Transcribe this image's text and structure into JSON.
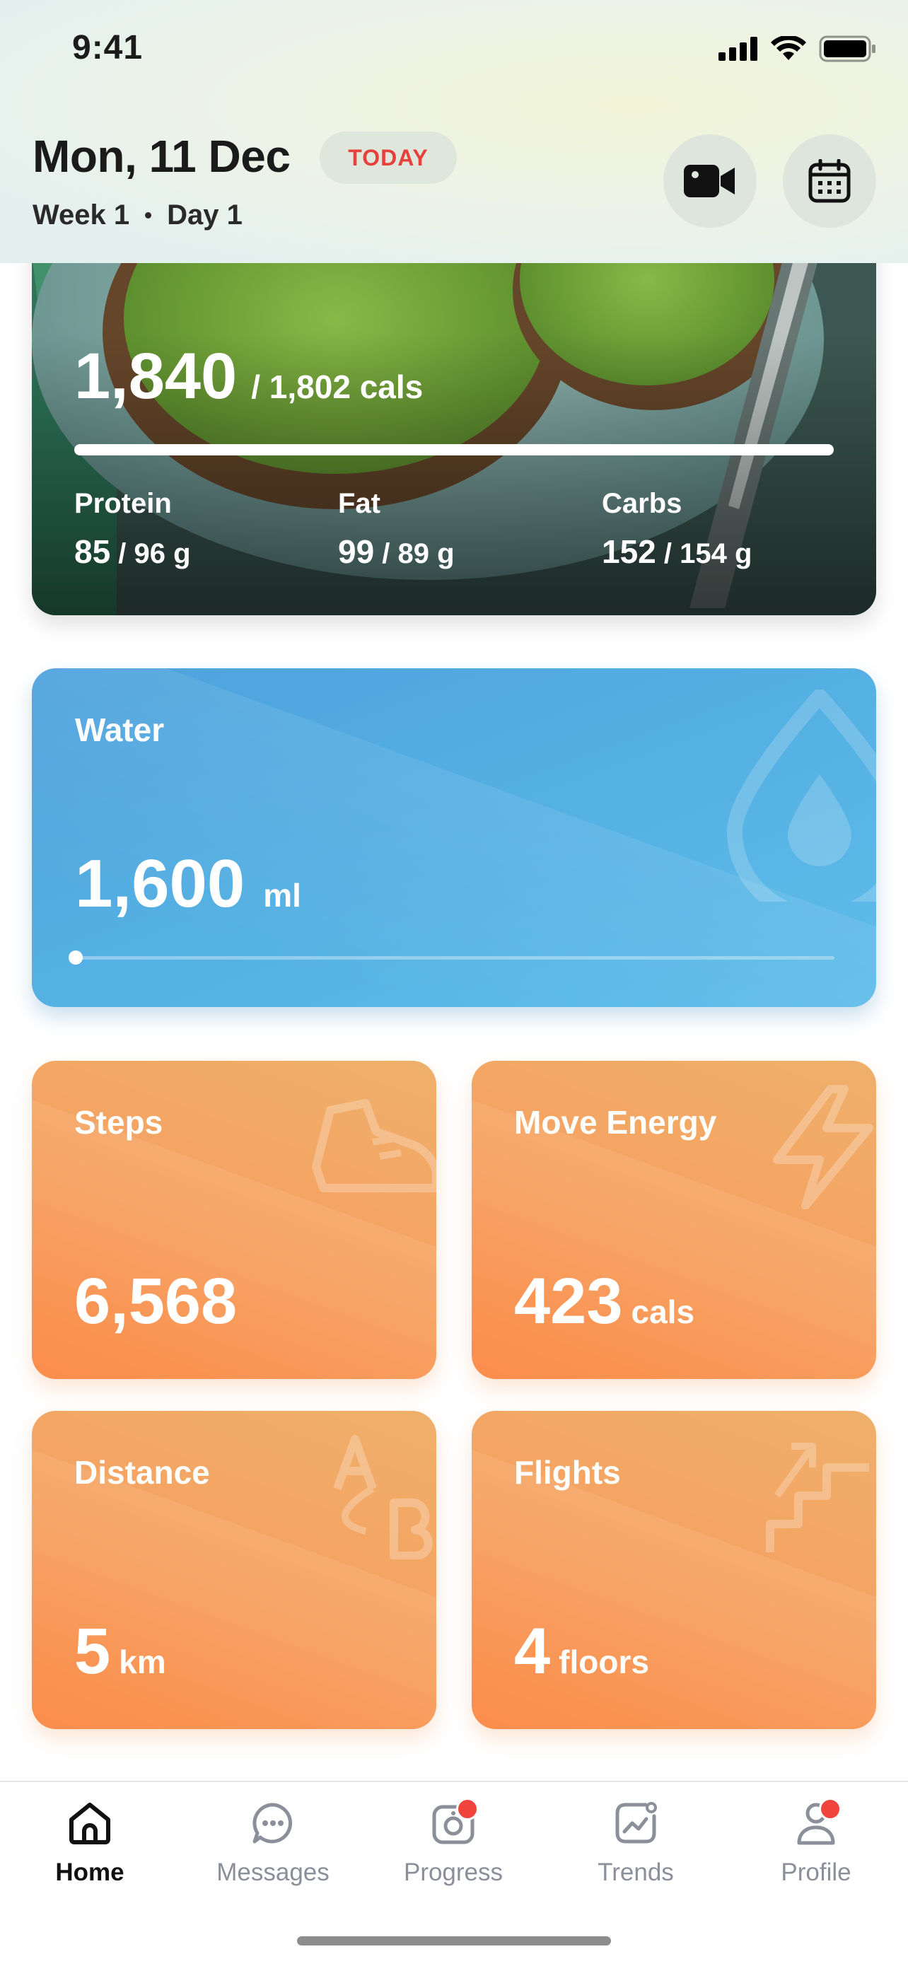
{
  "status_bar": {
    "time": "9:41"
  },
  "header": {
    "date": "Mon, 11 Dec",
    "badge": "TODAY",
    "week": "Week 1",
    "day": "Day 1",
    "icons": [
      "video-camera-icon",
      "calendar-icon"
    ]
  },
  "calories": {
    "consumed": "1,840",
    "target": "/ 1,802 cals",
    "progress": 1.0,
    "macros": [
      {
        "label": "Protein",
        "value": "85",
        "target": " / 96 g"
      },
      {
        "label": "Fat",
        "value": "99",
        "target": " / 89 g"
      },
      {
        "label": "Carbs",
        "value": "152",
        "target": " / 154 g"
      }
    ]
  },
  "water": {
    "label": "Water",
    "value": "1,600",
    "unit": "ml",
    "progress": 0.0,
    "icon": "water-drop-icon"
  },
  "tiles": {
    "steps": {
      "label": "Steps",
      "value": "6,568",
      "unit": "",
      "icon": "sneaker-icon"
    },
    "move_energy": {
      "label": "Move Energy",
      "value": "423",
      "unit": "cals",
      "icon": "lightning-icon"
    },
    "distance": {
      "label": "Distance",
      "value": "5",
      "unit": "km",
      "icon": "a-to-b-icon"
    },
    "flights": {
      "label": "Flights",
      "value": "4",
      "unit": "floors",
      "icon": "stairs-icon"
    }
  },
  "tabbar": {
    "items": [
      {
        "label": "Home",
        "icon": "home-icon",
        "active": true
      },
      {
        "label": "Messages",
        "icon": "chat-icon"
      },
      {
        "label": "Progress",
        "icon": "camera-icon",
        "badge": true
      },
      {
        "label": "Trends",
        "icon": "trends-icon"
      },
      {
        "label": "Profile",
        "icon": "person-icon",
        "badge": true
      }
    ]
  },
  "colors": {
    "water_card": "#55b0e3",
    "tile_orange": "#f7a060",
    "badge_red": "#e6413b",
    "notification_dot": "#f0443c"
  }
}
